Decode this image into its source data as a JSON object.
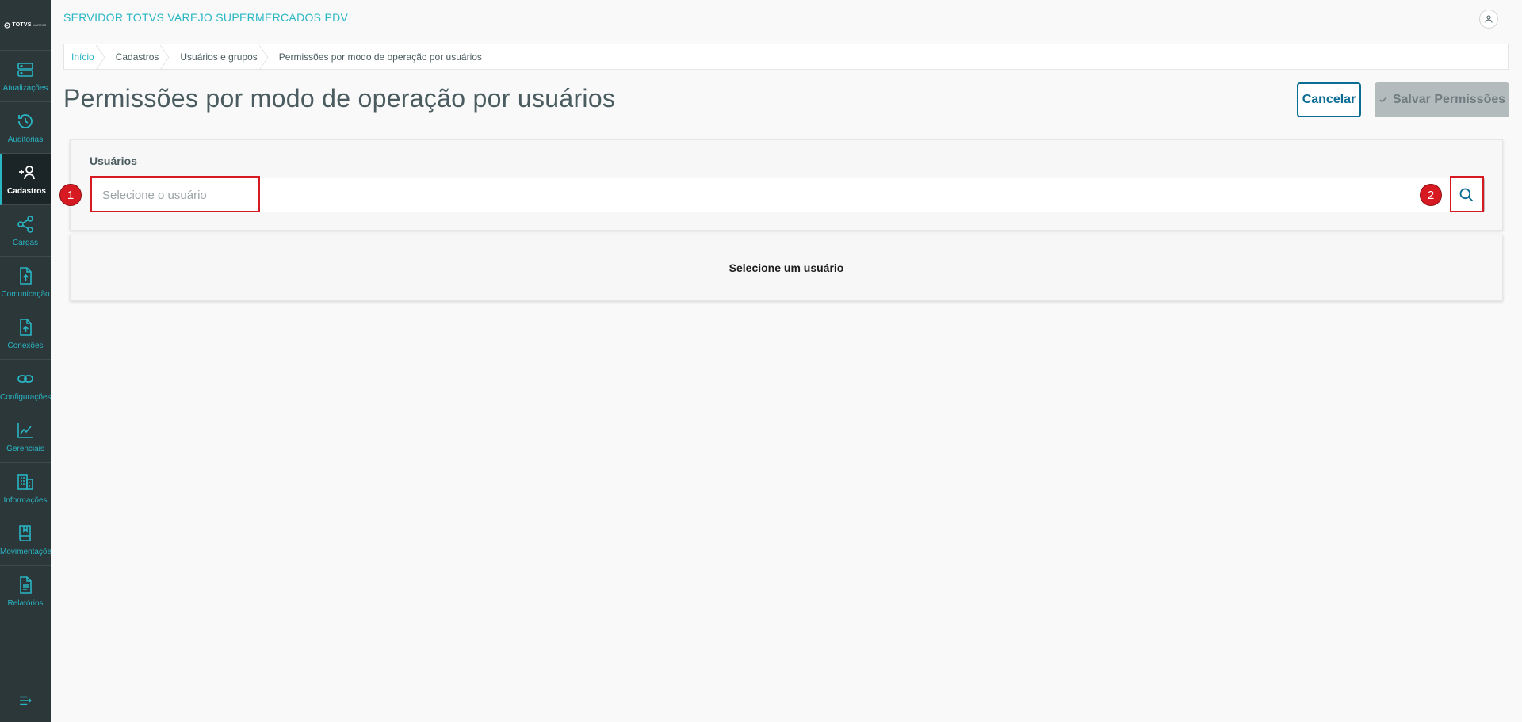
{
  "app": {
    "title": "SERVIDOR TOTVS VAREJO SUPERMERCADOS PDV",
    "logo_text": "TOTVS",
    "logo_sub": "VAREJO"
  },
  "sidebar": {
    "items": [
      {
        "label": "Atualizações",
        "icon": "server-icon"
      },
      {
        "label": "Auditorias",
        "icon": "history-icon"
      },
      {
        "label": "Cadastros",
        "icon": "user-add-icon",
        "active": true
      },
      {
        "label": "Cargas",
        "icon": "share-icon"
      },
      {
        "label": "Comunicação",
        "icon": "file-upload-icon"
      },
      {
        "label": "Conexões",
        "icon": "file-upload-icon"
      },
      {
        "label": "Configurações",
        "icon": "link-icon"
      },
      {
        "label": "Gerenciais",
        "icon": "chart-icon"
      },
      {
        "label": "Informações",
        "icon": "building-icon"
      },
      {
        "label": "Movimentações",
        "icon": "book-icon"
      },
      {
        "label": "Relatórios",
        "icon": "document-icon"
      }
    ],
    "collapse_icon": "collapse-menu-icon"
  },
  "breadcrumb": [
    "Início",
    "Cadastros",
    "Usuários e grupos",
    "Permissões por modo de operação por usuários"
  ],
  "page": {
    "title": "Permissões por modo de operação por usuários",
    "cancel_label": "Cancelar",
    "save_label": "Salvar Permissões"
  },
  "users_panel": {
    "label": "Usuários",
    "placeholder": "Selecione o usuário",
    "value": ""
  },
  "annotations": {
    "marker1": "1",
    "marker2": "2",
    "color": "#d71a21"
  },
  "result": {
    "empty_text": "Selecione um usuário"
  },
  "colors": {
    "accent": "#29b6c5",
    "primary": "#0c6c94",
    "sidebar_bg": "#2c3739"
  }
}
